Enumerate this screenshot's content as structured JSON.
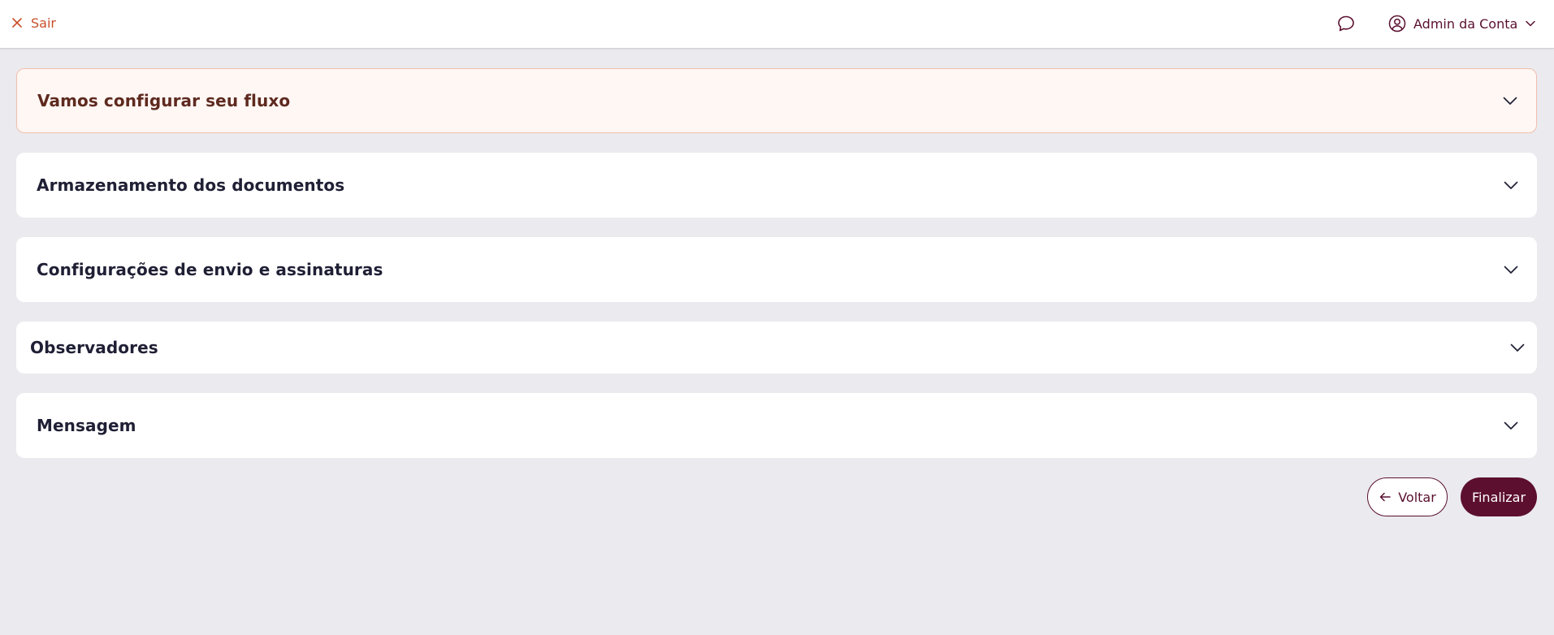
{
  "header": {
    "exit_label": "Sair",
    "account_name": "Admin da Conta"
  },
  "sections": [
    {
      "title": "Vamos configurar seu fluxo"
    },
    {
      "title": "Armazenamento dos documentos"
    },
    {
      "title": "Configurações de envio e assinaturas"
    },
    {
      "title": "Observadores"
    },
    {
      "title": "Mensagem"
    }
  ],
  "footer": {
    "back_label": "Voltar",
    "finish_label": "Finalizar"
  },
  "icons": {
    "exit": "close-icon",
    "chat": "chat-bubble-icon",
    "account": "user-circle-icon",
    "account_menu": "chevron-down-icon",
    "section_toggle": "chevron-down-icon",
    "back": "arrow-left-icon"
  },
  "colors": {
    "brand": "#5c0f2e",
    "accent_orange": "#c8502a",
    "highlight_bg": "#fff7f4",
    "page_bg": "#ebeaef"
  }
}
